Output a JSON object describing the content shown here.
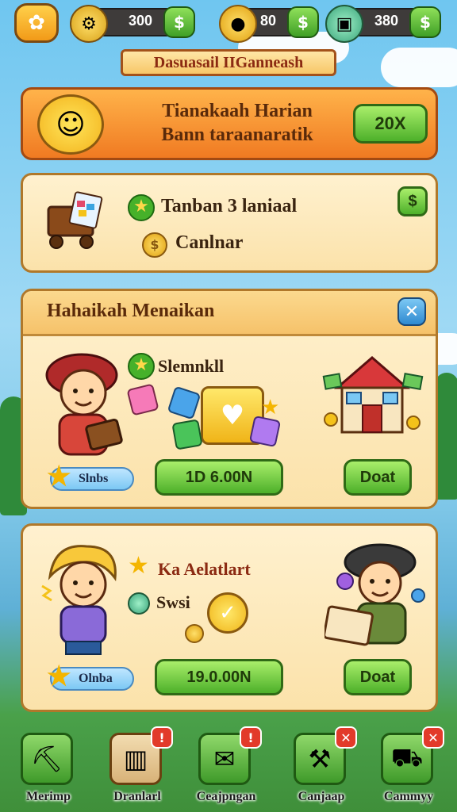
{
  "top_bar": {
    "logo_icon": "leaf-badge-icon",
    "resources": [
      {
        "icon": "gear-coin-icon",
        "value": "300",
        "action": "$"
      },
      {
        "icon": "gold-coin-icon",
        "value": "80",
        "action": "$"
      },
      {
        "icon": "gem-box-icon",
        "value": "380",
        "action": "$"
      }
    ]
  },
  "title": "Dasuasail IIGanneash",
  "banner": {
    "line1": "Tianakaah Harian",
    "line2": "Bann taraanaratik",
    "button_label": "20X"
  },
  "task": {
    "line1": "Tanban 3 laniaal",
    "line2": "Canlnar",
    "button_icon": "$"
  },
  "reward_panel": {
    "header": "Hahaikah Menaikan",
    "close_label": "✕",
    "item_label": "Slemnkll",
    "badge": "Slnbs",
    "price_button": "1D 6.00N",
    "deal_button": "Doat"
  },
  "card2": {
    "item_label": "Ka Aelatlart",
    "sub_label": "Swsi",
    "badge": "Olnba",
    "price_button": "19.0.00N",
    "deal_button": "Doat"
  },
  "nav": [
    {
      "label": "Merimp",
      "icon": "pickaxe-icon",
      "notif": ""
    },
    {
      "label": "Dranlarl",
      "icon": "door-icon",
      "notif": "!"
    },
    {
      "label": "Ceajpngan",
      "icon": "gift-icon",
      "notif": "!"
    },
    {
      "label": "Canjaap",
      "icon": "hammer-icon",
      "notif": "✕"
    },
    {
      "label": "Cammyy",
      "icon": "cart-icon",
      "notif": "✕"
    }
  ],
  "colors": {
    "accent_orange": "#f07a22",
    "accent_green": "#4db02a",
    "panel_bg": "#fbe2aa",
    "close_blue": "#2f8ad0"
  }
}
